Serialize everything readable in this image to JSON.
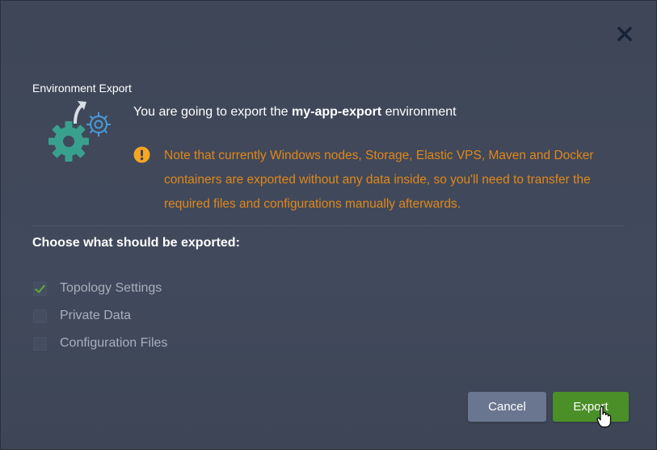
{
  "dialog": {
    "title": "Environment Export",
    "close_icon": "close-icon",
    "headline": {
      "prefix": "You are going to export the ",
      "env_name": "my-app-export",
      "suffix": " environment"
    },
    "warning": {
      "icon": "exclamation-circle-icon",
      "color": "#e0871a",
      "text": "Note that currently Windows nodes, Storage, Elastic VPS, Maven and Docker containers are exported without any data inside, so you'll need to transfer the required files and configurations manually afterwards."
    },
    "section_title": "Choose what should be exported:",
    "options": [
      {
        "label": "Topology Settings",
        "checked": true
      },
      {
        "label": "Private Data",
        "checked": false
      },
      {
        "label": "Configuration Files",
        "checked": false
      }
    ],
    "buttons": {
      "cancel": "Cancel",
      "export": "Export"
    },
    "colors": {
      "accent_green": "#4b8f29",
      "cancel_bg": "#6a7690",
      "gear_teal": "#3aa08e",
      "gear_blue": "#4a9bd6"
    }
  }
}
